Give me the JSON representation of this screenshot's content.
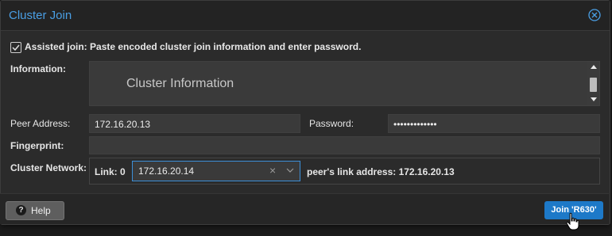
{
  "dialog": {
    "title": "Cluster Join"
  },
  "assisted": {
    "checked": true,
    "label": "Assisted join: Paste encoded cluster join information and enter password."
  },
  "information": {
    "label": "Information:",
    "placeholder": "Cluster Information"
  },
  "peer": {
    "label": "Peer Address:",
    "value": "172.16.20.13"
  },
  "password": {
    "label": "Password:",
    "value": "•••••••••••••"
  },
  "fingerprint": {
    "label": "Fingerprint:",
    "value": ""
  },
  "network": {
    "label": "Cluster Network:",
    "link_label": "Link:",
    "link_number": "0",
    "address": "172.16.20.14",
    "peer_text": "peer's link address: 172.16.20.13"
  },
  "buttons": {
    "help": "Help",
    "join": "Join 'R630'"
  },
  "colors": {
    "accent": "#4a9fe5",
    "primary_button": "#1d79c8",
    "background": "#2b2b2b"
  }
}
